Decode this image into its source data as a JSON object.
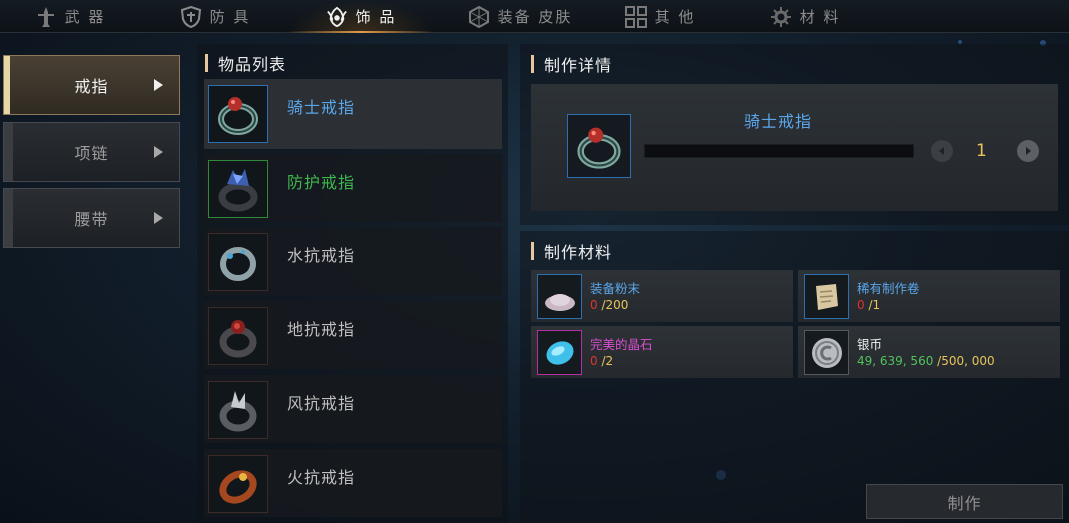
{
  "top_tabs": [
    {
      "label": "武 器",
      "icon": "weapon-icon"
    },
    {
      "label": "防 具",
      "icon": "armor-shield-icon"
    },
    {
      "label": "饰 品",
      "icon": "accessory-crest-icon",
      "active": true
    },
    {
      "label": "装备 皮肤",
      "icon": "equipment-skin-icon"
    },
    {
      "label": "其 他",
      "icon": "other-grid-icon"
    },
    {
      "label": "材 料",
      "icon": "material-gear-icon"
    }
  ],
  "categories": [
    {
      "label": "戒指",
      "active": true
    },
    {
      "label": "项链"
    },
    {
      "label": "腰带"
    }
  ],
  "item_list": {
    "title": "物品列表",
    "items": [
      {
        "name": "骑士戒指",
        "state": "selected",
        "icon": "knight-ring-icon"
      },
      {
        "name": "防护戒指",
        "state": "green",
        "icon": "protection-ring-icon"
      },
      {
        "name": "水抗戒指",
        "state": "normal",
        "icon": "water-resist-ring-icon"
      },
      {
        "name": "地抗戒指",
        "state": "normal",
        "icon": "earth-resist-ring-icon"
      },
      {
        "name": "风抗戒指",
        "state": "normal",
        "icon": "wind-resist-ring-icon"
      },
      {
        "name": "火抗戒指",
        "state": "normal",
        "icon": "fire-resist-ring-icon"
      }
    ]
  },
  "detail": {
    "title": "制作详情",
    "item_name": "骑士戒指",
    "quantity": "1",
    "quantity_progress": 0
  },
  "materials": {
    "title": "制作材料",
    "items": [
      {
        "name": "装备粉末",
        "have": "0",
        "need": "/200",
        "icon": "equipment-powder-icon"
      },
      {
        "name": "稀有制作卷",
        "have": "0",
        "need": "/1",
        "icon": "rare-craft-scroll-icon"
      },
      {
        "name": "完美的晶石",
        "have": "0",
        "need": "/2",
        "icon": "perfect-crystal-icon"
      },
      {
        "name": "银币",
        "have": "49, 639, 560",
        "need": "/500, 000",
        "icon": "silver-coin-icon"
      }
    ]
  },
  "craft_button": "制作",
  "colors": {
    "accent_gold": "#e09a4a",
    "selected_blue": "#5aa6ea",
    "uncommon_green": "#3fb64e",
    "epic_pink": "#d94ed0",
    "insufficient_red": "#e0332f",
    "count_yellow": "#e8c35a"
  }
}
